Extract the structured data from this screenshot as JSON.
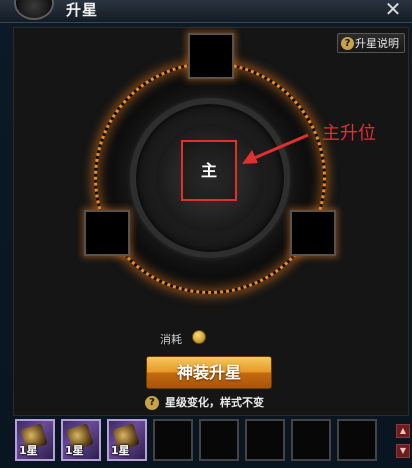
{
  "window": {
    "title": "升星",
    "close_icon": "close-icon"
  },
  "help_button": {
    "label": "升星说明",
    "icon": "question-icon"
  },
  "dial": {
    "main_slot_label": "主",
    "side_slots": [
      "top-slot",
      "left-slot",
      "right-slot"
    ]
  },
  "annotation": {
    "text": "主升位",
    "color": "#e03030"
  },
  "cost": {
    "label": "消耗",
    "icon": "coin-icon"
  },
  "upgrade_button": {
    "label": "神装升星"
  },
  "note": {
    "text": "星级变化，样式不变",
    "icon": "question-icon"
  },
  "inventory": {
    "items": [
      {
        "label": "1星"
      },
      {
        "label": "1星"
      },
      {
        "label": "1星"
      }
    ],
    "empty_slots": 5,
    "scroll_up_icon": "arrow-up-icon",
    "scroll_down_icon": "arrow-down-icon"
  },
  "colors": {
    "accent": "#e69a26",
    "highlight": "#e0302a",
    "glow": "#e98a2a"
  }
}
